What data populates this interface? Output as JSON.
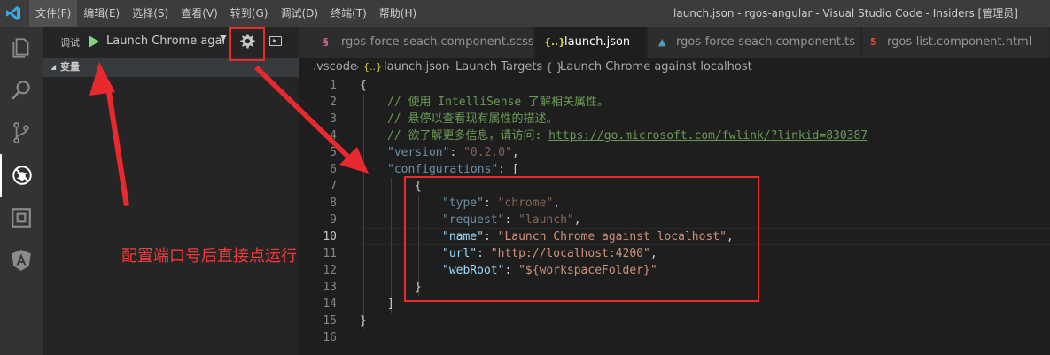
{
  "window": {
    "title": "launch.json - rgos-angular - Visual Studio Code - Insiders [管理员]",
    "menus": [
      "文件(F)",
      "编辑(E)",
      "选择(S)",
      "查看(V)",
      "转到(G)",
      "调试(D)",
      "终端(T)",
      "帮助(H)"
    ]
  },
  "activity_bar": {
    "icons": [
      "explorer-icon",
      "search-icon",
      "source-control-icon",
      "debug-icon",
      "extensions-icon",
      "angular-icon"
    ],
    "active": "debug-icon"
  },
  "debug": {
    "label": "调试",
    "configuration": "Launch Chrome agai",
    "variables_section": "变量"
  },
  "tabs": [
    {
      "label": "rgos-force-seach.component.scss",
      "icon_text": "§",
      "icon_color": "#cd6799",
      "active": false
    },
    {
      "label": "launch.json",
      "icon_text": "{..}",
      "icon_color": "#cbcb41",
      "active": true
    },
    {
      "label": "rgos-force-seach.component.ts",
      "icon_text": "▲",
      "icon_color": "#519aba",
      "active": false
    },
    {
      "label": "rgos-list.component.html",
      "icon_text": "5",
      "icon_color": "#e44d26",
      "active": false
    }
  ],
  "breadcrumb": {
    "folder": ".vscode",
    "file_icon": "{..}",
    "file": "launch.json",
    "section": "Launch Targets",
    "item_icon": "{ }",
    "item": "Launch Chrome against localhost"
  },
  "editor": {
    "current_line": 10,
    "lines": [
      {
        "num": "1",
        "indent": 0,
        "parts": [
          {
            "t": "{",
            "c": ""
          }
        ]
      },
      {
        "num": "2",
        "indent": 1,
        "parts": [
          {
            "t": "// 使用 IntelliSense 了解相关属性。",
            "c": "comment"
          }
        ]
      },
      {
        "num": "3",
        "indent": 1,
        "parts": [
          {
            "t": "// 悬停以查看现有属性的描述。",
            "c": "comment"
          }
        ]
      },
      {
        "num": "4",
        "indent": 1,
        "parts": [
          {
            "t": "// 欲了解更多信息，请访问: ",
            "c": "comment"
          },
          {
            "t": "https://go.microsoft.com/fwlink/?linkid=830387",
            "c": "link"
          }
        ]
      },
      {
        "num": "5",
        "indent": 1,
        "parts": [
          {
            "t": "\"version\"",
            "c": "key dim"
          },
          {
            "t": ": ",
            "c": ""
          },
          {
            "t": "\"0.2.0\"",
            "c": "string dim"
          },
          {
            "t": ",",
            "c": ""
          }
        ]
      },
      {
        "num": "6",
        "indent": 1,
        "parts": [
          {
            "t": "\"configurations\"",
            "c": "key dim"
          },
          {
            "t": ": [",
            "c": ""
          }
        ]
      },
      {
        "num": "7",
        "indent": 2,
        "parts": [
          {
            "t": "{",
            "c": ""
          }
        ]
      },
      {
        "num": "8",
        "indent": 3,
        "parts": [
          {
            "t": "\"type\"",
            "c": "key dim"
          },
          {
            "t": ": ",
            "c": ""
          },
          {
            "t": "\"chrome\"",
            "c": "string dim"
          },
          {
            "t": ",",
            "c": ""
          }
        ]
      },
      {
        "num": "9",
        "indent": 3,
        "parts": [
          {
            "t": "\"request\"",
            "c": "key dim"
          },
          {
            "t": ": ",
            "c": ""
          },
          {
            "t": "\"launch\"",
            "c": "string dim"
          },
          {
            "t": ",",
            "c": ""
          }
        ]
      },
      {
        "num": "10",
        "indent": 3,
        "parts": [
          {
            "t": "\"name\"",
            "c": "key"
          },
          {
            "t": ": ",
            "c": ""
          },
          {
            "t": "\"Launch Chrome against localhost\"",
            "c": "string"
          },
          {
            "t": ",",
            "c": ""
          }
        ]
      },
      {
        "num": "11",
        "indent": 3,
        "parts": [
          {
            "t": "\"url\"",
            "c": "key"
          },
          {
            "t": ": ",
            "c": ""
          },
          {
            "t": "\"http://localhost:4200\"",
            "c": "string"
          },
          {
            "t": ",",
            "c": ""
          }
        ]
      },
      {
        "num": "12",
        "indent": 3,
        "parts": [
          {
            "t": "\"webRoot\"",
            "c": "key"
          },
          {
            "t": ": ",
            "c": ""
          },
          {
            "t": "\"${workspaceFolder}\"",
            "c": "string"
          }
        ]
      },
      {
        "num": "13",
        "indent": 2,
        "parts": [
          {
            "t": "}",
            "c": ""
          }
        ]
      },
      {
        "num": "14",
        "indent": 1,
        "parts": [
          {
            "t": "]",
            "c": ""
          }
        ]
      },
      {
        "num": "15",
        "indent": 0,
        "parts": [
          {
            "t": "}",
            "c": ""
          }
        ]
      },
      {
        "num": "16",
        "indent": 0,
        "parts": []
      }
    ]
  },
  "annotation": {
    "text": "配置端口号后直接点运行",
    "color": "#e8292e"
  },
  "colors": {
    "accent_blue": "#007acc",
    "title_bar": "#3c3c3c",
    "activity_bar": "#333333",
    "sidebar": "#252526",
    "editor_bg": "#1e1e1e",
    "run_green": "#89d185"
  }
}
